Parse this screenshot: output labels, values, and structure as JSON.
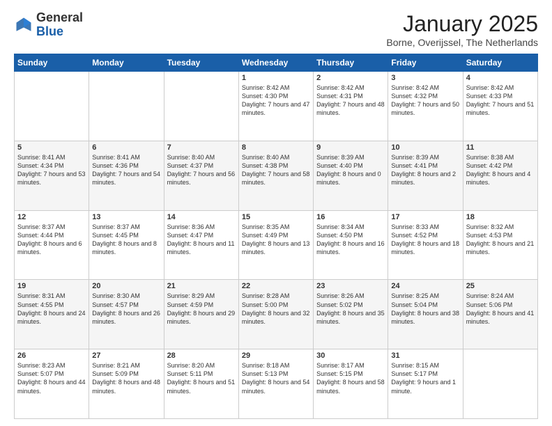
{
  "header": {
    "logo_general": "General",
    "logo_blue": "Blue",
    "month_title": "January 2025",
    "location": "Borne, Overijssel, The Netherlands"
  },
  "days_of_week": [
    "Sunday",
    "Monday",
    "Tuesday",
    "Wednesday",
    "Thursday",
    "Friday",
    "Saturday"
  ],
  "weeks": [
    [
      {
        "day": "",
        "text": ""
      },
      {
        "day": "",
        "text": ""
      },
      {
        "day": "",
        "text": ""
      },
      {
        "day": "1",
        "text": "Sunrise: 8:42 AM\nSunset: 4:30 PM\nDaylight: 7 hours\nand 47 minutes."
      },
      {
        "day": "2",
        "text": "Sunrise: 8:42 AM\nSunset: 4:31 PM\nDaylight: 7 hours\nand 48 minutes."
      },
      {
        "day": "3",
        "text": "Sunrise: 8:42 AM\nSunset: 4:32 PM\nDaylight: 7 hours\nand 50 minutes."
      },
      {
        "day": "4",
        "text": "Sunrise: 8:42 AM\nSunset: 4:33 PM\nDaylight: 7 hours\nand 51 minutes."
      }
    ],
    [
      {
        "day": "5",
        "text": "Sunrise: 8:41 AM\nSunset: 4:34 PM\nDaylight: 7 hours\nand 53 minutes."
      },
      {
        "day": "6",
        "text": "Sunrise: 8:41 AM\nSunset: 4:36 PM\nDaylight: 7 hours\nand 54 minutes."
      },
      {
        "day": "7",
        "text": "Sunrise: 8:40 AM\nSunset: 4:37 PM\nDaylight: 7 hours\nand 56 minutes."
      },
      {
        "day": "8",
        "text": "Sunrise: 8:40 AM\nSunset: 4:38 PM\nDaylight: 7 hours\nand 58 minutes."
      },
      {
        "day": "9",
        "text": "Sunrise: 8:39 AM\nSunset: 4:40 PM\nDaylight: 8 hours\nand 0 minutes."
      },
      {
        "day": "10",
        "text": "Sunrise: 8:39 AM\nSunset: 4:41 PM\nDaylight: 8 hours\nand 2 minutes."
      },
      {
        "day": "11",
        "text": "Sunrise: 8:38 AM\nSunset: 4:42 PM\nDaylight: 8 hours\nand 4 minutes."
      }
    ],
    [
      {
        "day": "12",
        "text": "Sunrise: 8:37 AM\nSunset: 4:44 PM\nDaylight: 8 hours\nand 6 minutes."
      },
      {
        "day": "13",
        "text": "Sunrise: 8:37 AM\nSunset: 4:45 PM\nDaylight: 8 hours\nand 8 minutes."
      },
      {
        "day": "14",
        "text": "Sunrise: 8:36 AM\nSunset: 4:47 PM\nDaylight: 8 hours\nand 11 minutes."
      },
      {
        "day": "15",
        "text": "Sunrise: 8:35 AM\nSunset: 4:49 PM\nDaylight: 8 hours\nand 13 minutes."
      },
      {
        "day": "16",
        "text": "Sunrise: 8:34 AM\nSunset: 4:50 PM\nDaylight: 8 hours\nand 16 minutes."
      },
      {
        "day": "17",
        "text": "Sunrise: 8:33 AM\nSunset: 4:52 PM\nDaylight: 8 hours\nand 18 minutes."
      },
      {
        "day": "18",
        "text": "Sunrise: 8:32 AM\nSunset: 4:53 PM\nDaylight: 8 hours\nand 21 minutes."
      }
    ],
    [
      {
        "day": "19",
        "text": "Sunrise: 8:31 AM\nSunset: 4:55 PM\nDaylight: 8 hours\nand 24 minutes."
      },
      {
        "day": "20",
        "text": "Sunrise: 8:30 AM\nSunset: 4:57 PM\nDaylight: 8 hours\nand 26 minutes."
      },
      {
        "day": "21",
        "text": "Sunrise: 8:29 AM\nSunset: 4:59 PM\nDaylight: 8 hours\nand 29 minutes."
      },
      {
        "day": "22",
        "text": "Sunrise: 8:28 AM\nSunset: 5:00 PM\nDaylight: 8 hours\nand 32 minutes."
      },
      {
        "day": "23",
        "text": "Sunrise: 8:26 AM\nSunset: 5:02 PM\nDaylight: 8 hours\nand 35 minutes."
      },
      {
        "day": "24",
        "text": "Sunrise: 8:25 AM\nSunset: 5:04 PM\nDaylight: 8 hours\nand 38 minutes."
      },
      {
        "day": "25",
        "text": "Sunrise: 8:24 AM\nSunset: 5:06 PM\nDaylight: 8 hours\nand 41 minutes."
      }
    ],
    [
      {
        "day": "26",
        "text": "Sunrise: 8:23 AM\nSunset: 5:07 PM\nDaylight: 8 hours\nand 44 minutes."
      },
      {
        "day": "27",
        "text": "Sunrise: 8:21 AM\nSunset: 5:09 PM\nDaylight: 8 hours\nand 48 minutes."
      },
      {
        "day": "28",
        "text": "Sunrise: 8:20 AM\nSunset: 5:11 PM\nDaylight: 8 hours\nand 51 minutes."
      },
      {
        "day": "29",
        "text": "Sunrise: 8:18 AM\nSunset: 5:13 PM\nDaylight: 8 hours\nand 54 minutes."
      },
      {
        "day": "30",
        "text": "Sunrise: 8:17 AM\nSunset: 5:15 PM\nDaylight: 8 hours\nand 58 minutes."
      },
      {
        "day": "31",
        "text": "Sunrise: 8:15 AM\nSunset: 5:17 PM\nDaylight: 9 hours\nand 1 minute."
      },
      {
        "day": "",
        "text": ""
      }
    ]
  ]
}
